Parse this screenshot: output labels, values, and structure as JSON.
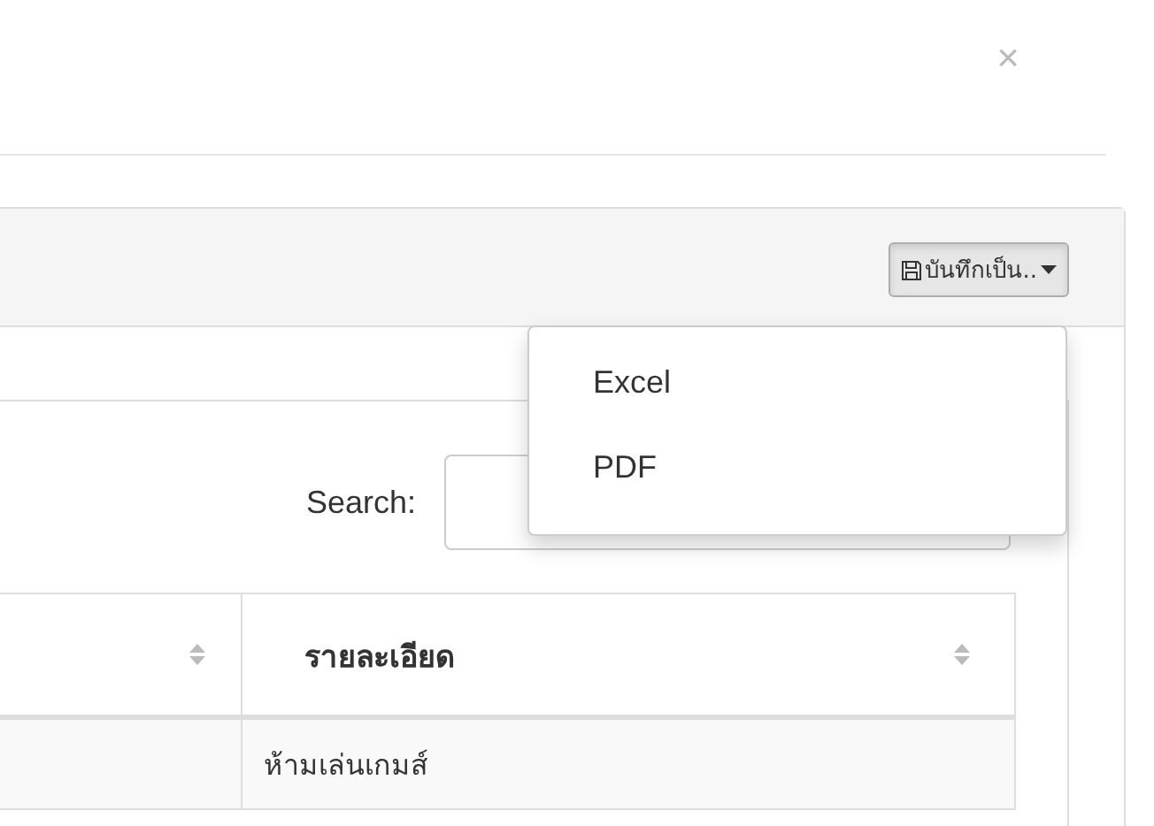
{
  "dialog": {
    "close": "×"
  },
  "panel": {
    "save_button": {
      "label": "บันทึกเป็น..",
      "expanded": true
    },
    "menu": [
      {
        "label": "Excel"
      },
      {
        "label": "PDF"
      }
    ],
    "search": {
      "label": "Search:"
    },
    "table": {
      "columns": [
        {
          "sortable": true
        },
        {
          "label": "รายละเอียด",
          "sortable": true
        }
      ],
      "rows": [
        {
          "column_2": "ห้ามเล่นเกมส์"
        }
      ]
    }
  }
}
